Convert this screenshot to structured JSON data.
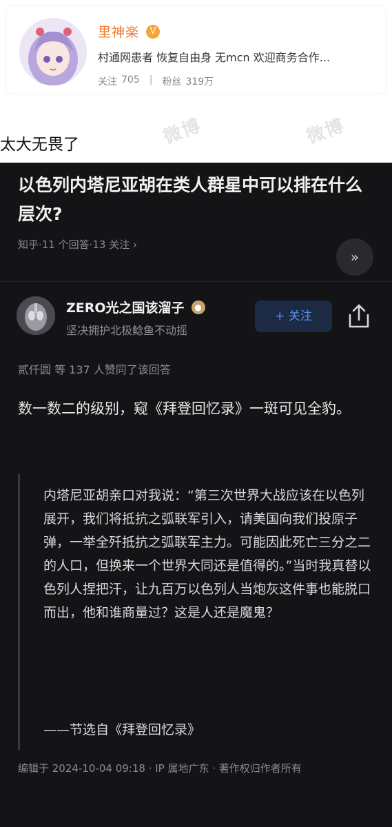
{
  "profile": {
    "name": "里神楽",
    "verified_icon": "verified-badge-icon",
    "bio": "村通网患者 恢复自由身 无mcn 欢迎商务合作...",
    "following_label": "关注",
    "following_count": "705",
    "separator": "|",
    "followers_label": "粉丝",
    "followers_count": "319万"
  },
  "post": {
    "caption": "太大无畏了"
  },
  "zhihu": {
    "question_title": "以色列内塔尼亚胡在类人群星中可以排在什么层次?",
    "question_meta": "知乎·11 个回答·13 关注 ›",
    "collapse_icon": "double-chevron-down-icon",
    "author": {
      "name": "ZERO光之国该溜子",
      "bio": "坚决拥护北极鲶鱼不动摇",
      "follow_label": "+ 关注"
    },
    "upvote_text": "贰仟圆 等 137 人赞同了该回答",
    "answer_text": "数一数二的级别，窥《拜登回忆录》一斑可见全豹。",
    "quote_text": "内塔尼亚胡亲口对我说：“第三次世界大战应该在以色列展开，我们将抵抗之弧联军引入，请美国向我们投原子弹，一举全歼抵抗之弧联军主力。可能因此死亡三分之二的人口，但换来一个世界大同还是值得的。”当时我真替以色列人捏把汗，让九百万以色列人当炮灰这件事也能脱口而出，他和谁商量过？这是人还是魔鬼？",
    "quote_source": "——节选自《拜登回忆录》",
    "edit_info": "编辑于 2024-10-04 09:18 · IP 属地广东 · 著作权归作者所有"
  },
  "colors": {
    "weibo_name": "#f07c2c",
    "zhihu_bg": "#141416",
    "follow_blue": "#5b8ff0"
  }
}
